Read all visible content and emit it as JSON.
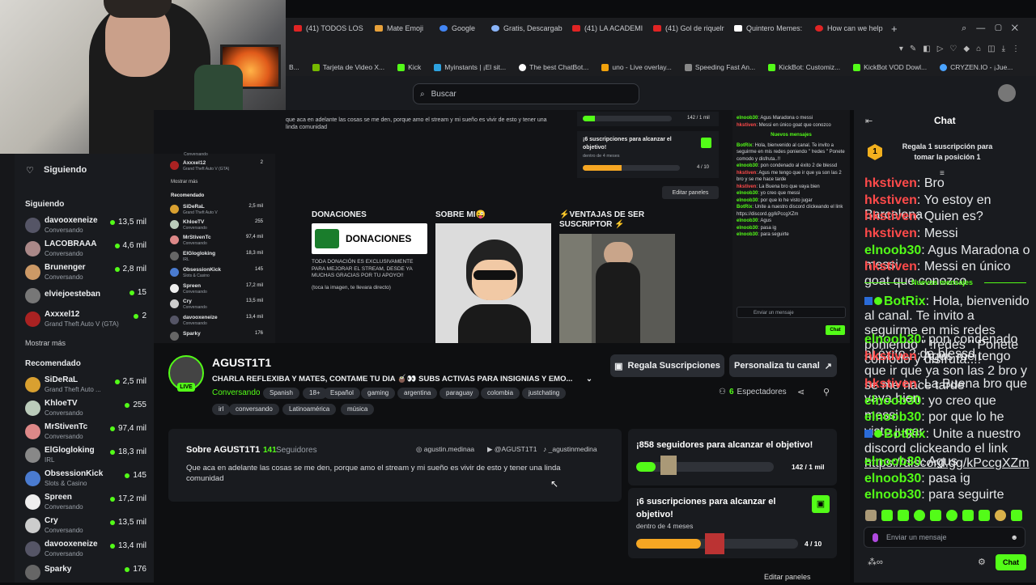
{
  "browser": {
    "tabs": [
      "(41) TODOS LOS",
      "Mate Emoji",
      "Google",
      "Gratis, Descargab",
      "(41) LA ACADEMI",
      "(41) Gol de riquelr",
      "Quintero Memes:",
      "How can we help"
    ],
    "bookmarks": [
      "B...",
      "Tarjeta de Video X...",
      "Kick",
      "Myinstants | ¡El sit...",
      "The best ChatBot...",
      "uno - Live overlay...",
      "Speeding Fast An...",
      "KickBot: Customiz...",
      "KickBot VOD Dowl...",
      "CRYZEN.IO - ¡Jue..."
    ]
  },
  "header": {
    "search_placeholder": "Buscar"
  },
  "sidebar": {
    "title": "Siguiendo",
    "following_label": "Siguiendo",
    "following": [
      {
        "name": "davooxeneize",
        "sub": "Conversando",
        "viewers": "13,5 mil"
      },
      {
        "name": "LACOBRAAA",
        "sub": "Conversando",
        "viewers": "4,6 mil"
      },
      {
        "name": "Brunenger",
        "sub": "Conversando",
        "viewers": "2,8 mil"
      },
      {
        "name": "elviejoesteban",
        "sub": "",
        "viewers": "15"
      },
      {
        "name": "Axxxel12",
        "sub": "Grand Theft Auto V (GTA)",
        "viewers": "2"
      }
    ],
    "more": "Mostrar más",
    "recommended_label": "Recomendado",
    "recommended": [
      {
        "name": "SiDeRaL",
        "sub": "Grand Theft Auto ...",
        "viewers": "2,5 mil"
      },
      {
        "name": "KhloeTV",
        "sub": "Conversando",
        "viewers": "255"
      },
      {
        "name": "MrStivenTc",
        "sub": "Conversando",
        "viewers": "97,4 mil"
      },
      {
        "name": "ElGlogloking",
        "sub": "IRL",
        "viewers": "18,3 mil"
      },
      {
        "name": "ObsessionKick",
        "sub": "Slots & Casino",
        "viewers": "145"
      },
      {
        "name": "Spreen",
        "sub": "Conversando",
        "viewers": "17,2 mil"
      },
      {
        "name": "Cry",
        "sub": "Conversando",
        "viewers": "13,5 mil"
      },
      {
        "name": "davooxeneize",
        "sub": "Conversando",
        "viewers": "13,4 mil"
      },
      {
        "name": "Sparky",
        "sub": "",
        "viewers": "176"
      }
    ]
  },
  "nested": {
    "about_text": "que aca en adelante las cosas se me den, porque amo el stream y mi sueño es vivir de esto y tener una linda comunidad",
    "goal_subs": "¡6 suscripciones para alcanzar el objetivo!",
    "goal_subs_time": "dentro de 4 meses",
    "goal_subs_count": "4 / 10",
    "goal_fol_count": "142 / 1 mil",
    "edit_panels": "Editar paneles",
    "panel1_title": "DONACIONES",
    "panel1_banner": "DONACIONES",
    "panel1_text": "TODA DONACIÓN ES EXCLUSIVAMENTE PARA MEJORAR EL STREAM, DESDE YA MUCHAS GRACIAS POR TU APOYO!!",
    "panel1_note": "(toca la imagen, te llevara directo)",
    "panel2_title": "SOBRE MI😜",
    "panel3_title": "⚡VENTAJAS DE SER SUSCRIPTOR ⚡",
    "sidebar": [
      {
        "name": "Axxxel12",
        "sub": "Grand Theft Auto V (GTA)",
        "viewers": "2"
      },
      {
        "name": "SiDeRaL",
        "sub": "Grand Theft Auto V",
        "viewers": "2,5 mil"
      },
      {
        "name": "KhloeTV",
        "sub": "Conversando",
        "viewers": "255"
      },
      {
        "name": "MrStivenTc",
        "sub": "Conversando",
        "viewers": "97,4 mil"
      },
      {
        "name": "ElGlogloking",
        "sub": "IRL",
        "viewers": "18,3 mil"
      },
      {
        "name": "ObsessionKick",
        "sub": "Slots & Casino",
        "viewers": "145"
      },
      {
        "name": "Spreen",
        "sub": "Conversando",
        "viewers": "17,2 mil"
      },
      {
        "name": "Cry",
        "sub": "Conversando",
        "viewers": "13,5 mil"
      },
      {
        "name": "davooxeneize",
        "sub": "Conversando",
        "viewers": "13,4 mil"
      },
      {
        "name": "Sparky",
        "sub": "",
        "viewers": "176"
      }
    ],
    "sb_more": "Mostrar más",
    "sb_reco": "Recomendado",
    "sb_top_sub": "Conversando",
    "chat_lines": [
      [
        "elnoob30",
        ": Agus Maradona o messi",
        "g"
      ],
      [
        "hkstiven",
        ": Messi en único goat que conozco",
        "r"
      ],
      [
        "",
        "Nuevos mensajes",
        "n"
      ],
      [
        "BotRix",
        ": Hola, bienvenido al canal. Te invito a seguirme en mis redes poniendo \" !redes \" Ponete comodo y disfruta..!!",
        "g"
      ],
      [
        "elnoob30",
        ": pon condenado al éxito 2 de blessd",
        "g"
      ],
      [
        "hkstiven",
        ": Agus me tengo que ir que ya son las 2 bro y se me hace tarde",
        "r"
      ],
      [
        "hkstiven",
        ": La Buena bro que vaya bien",
        "r"
      ],
      [
        "elnoob30",
        ": yo creo que messi",
        "g"
      ],
      [
        "elnoob30",
        ": por que lo he visto jugar",
        "g"
      ],
      [
        "BotRix",
        ": Unite a nuestro discord clickeando el link https://discord.gg/kPccgXZm",
        "g"
      ],
      [
        "elnoob30",
        ": Agus",
        "g"
      ],
      [
        "elnoob30",
        ": pasa ig",
        "g"
      ],
      [
        "elnoob30",
        ": para seguirte",
        "g"
      ]
    ],
    "chat_input": "Enviar un mensaje",
    "chat_btn": "Chat"
  },
  "channel": {
    "name": "AGUST1T1",
    "live": "LIVE",
    "title": "CHARLA REFLEXIBA Y MATES, CONTAME TU DIA 🧉👀 SUBS ACTIVAS PARA INSIGNIAS Y EMO...",
    "category": "Conversando",
    "tags": [
      "Spanish",
      "18+",
      "Español",
      "gaming",
      "argentina",
      "paraguay",
      "colombia",
      "justchating",
      "irl",
      "conversando",
      "Latinoamérica",
      "música"
    ],
    "btn_subs": "Regala Suscripciones",
    "btn_custom": "Personaliza tu canal",
    "viewers_count": "6",
    "viewers_label": "Espectadores"
  },
  "about": {
    "title": "Sobre AGUST1T1",
    "followers_count": "141",
    "followers_label": "Seguidores",
    "instagram": "agustin.medinaa",
    "youtube": "@AGUST1T1",
    "tiktok": "_agustinmedina",
    "text": "Que aca en adelante las cosas se me den, porque amo el stream y mi sueño es vivir de esto y tener una linda comunidad"
  },
  "goals": {
    "followers_title": "¡858 seguidores para alcanzar el objetivo!",
    "followers_count": "142 / 1 mil",
    "followers_progress": 0.142,
    "subs_title": "¡6 suscripciones para alcanzar el objetivo!",
    "subs_time": "dentro de 4 meses",
    "subs_count": "4 / 10",
    "subs_progress": 0.4,
    "edit_panels": "Editar paneles"
  },
  "chat": {
    "title": "Chat",
    "gift_banner": "Regala 1 suscripción para tomar la posición 1",
    "gift_rank": "1",
    "new_messages": "Nuevos mensajes",
    "messages_before": [
      {
        "user": "hkstiven",
        "text": ": Bro",
        "color": "red"
      },
      {
        "user": "hkstiven",
        "text": ": Yo estoy en Barcelona",
        "color": "red"
      },
      {
        "user": "hkstiven",
        "text": ": Quien es?",
        "color": "red"
      },
      {
        "user": "hkstiven",
        "text": ": Messi",
        "color": "red"
      },
      {
        "user": "elnoob30",
        "text": ": Agus Maradona o messi",
        "color": "green"
      },
      {
        "user": "hkstiven",
        "text": ": Messi en único goat que conozco",
        "color": "red"
      }
    ],
    "messages_after": [
      {
        "user": "BotRix",
        "text": ": Hola, bienvenido al canal. Te invito a seguirme en mis redes poniendo \" !redes \" Ponete comodo y disfruta..!!",
        "color": "green"
      },
      {
        "user": "elnoob30",
        "text": ": pon condenado al éxito 2 de blessd",
        "color": "green"
      },
      {
        "user": "hkstiven",
        "text": ": Agus me tengo que ir que ya son las 2 bro y se me hace tarde",
        "color": "red"
      },
      {
        "user": "hkstiven",
        "text": ": La Buena bro que vaya bien",
        "color": "red"
      },
      {
        "user": "elnoob30",
        "text": ": yo creo que messi",
        "color": "green"
      },
      {
        "user": "elnoob30",
        "text": ": por que lo he visto jugar",
        "color": "green"
      },
      {
        "user": "BotRix",
        "text": ": Unite a nuestro discord clickeando el link ",
        "link": "https://discord.gg/kPccgXZm",
        "color": "green"
      },
      {
        "user": "elnoob30",
        "text": ": Agus",
        "color": "green"
      },
      {
        "user": "elnoob30",
        "text": ": pasa ig",
        "color": "green"
      },
      {
        "user": "elnoob30",
        "text": ": para seguirte",
        "color": "green"
      }
    ],
    "input_placeholder": "Enviar un mensaje",
    "send_label": "Chat"
  },
  "colors": {
    "accent": "#53fc18",
    "red_user": "#ff4a4a",
    "bg": "#0e0f11",
    "panel": "#191b1f"
  }
}
